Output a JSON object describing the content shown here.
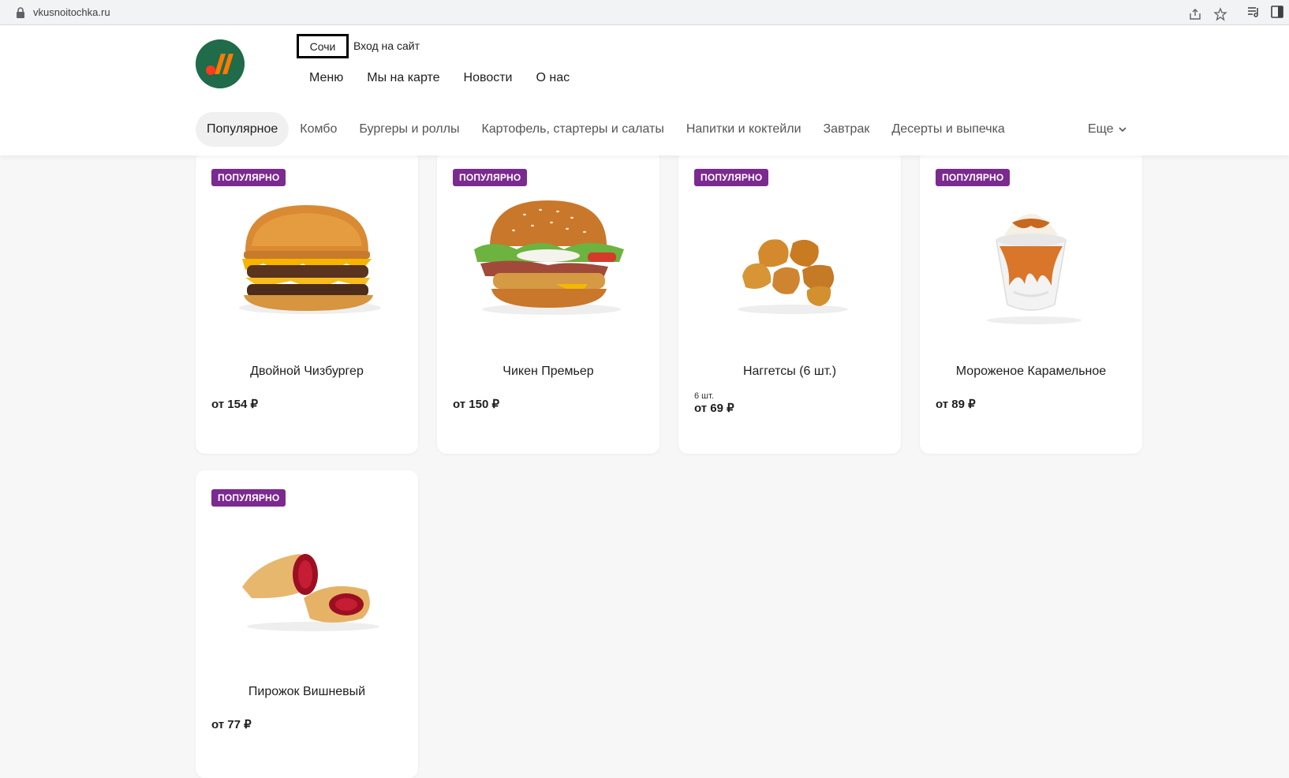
{
  "browser": {
    "url": "vkusnoitochka.ru"
  },
  "header": {
    "city": "Сочи",
    "login": "Вход на сайт",
    "nav": [
      "Меню",
      "Мы на карте",
      "Новости",
      "О нас"
    ]
  },
  "categories": {
    "items": [
      "Популярное",
      "Комбо",
      "Бургеры и роллы",
      "Картофель, стартеры и салаты",
      "Напитки и коктейли",
      "Завтрак",
      "Десерты и выпечка"
    ],
    "active": "Популярное",
    "more": "Еще"
  },
  "products": [
    {
      "badge": "ПОПУЛЯРНО",
      "name": "Двойной Чизбургер",
      "portion": "",
      "price": "от 154 ₽",
      "icon": "double-cheeseburger-image"
    },
    {
      "badge": "ПОПУЛЯРНО",
      "name": "Чикен Премьер",
      "portion": "",
      "price": "от 150 ₽",
      "icon": "chicken-premier-image"
    },
    {
      "badge": "ПОПУЛЯРНО",
      "name": "Наггетсы (6 шт.)",
      "portion": "6 шт.",
      "price": "от 69 ₽",
      "icon": "nuggets-image"
    },
    {
      "badge": "ПОПУЛЯРНО",
      "name": "Мороженое Карамельное",
      "portion": "",
      "price": "от 89 ₽",
      "icon": "caramel-sundae-image"
    },
    {
      "badge": "ПОПУЛЯРНО",
      "name": "Пирожок Вишневый",
      "portion": "",
      "price": "от 77 ₽",
      "icon": "cherry-pie-image"
    }
  ],
  "colors": {
    "brand_green": "#1f6b4a",
    "brand_orange": "#ff7a00",
    "brand_red": "#ff3a1f",
    "badge": "#7b2a90"
  }
}
